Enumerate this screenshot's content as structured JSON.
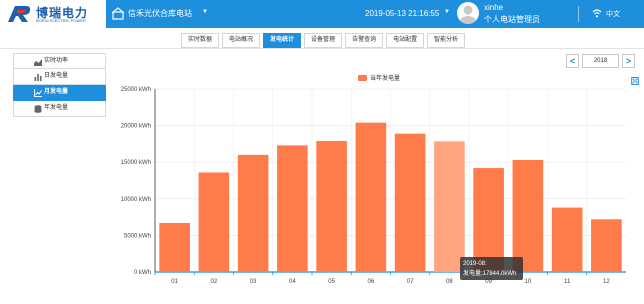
{
  "header": {
    "brand": "博瑞电力",
    "brand_sub": "BORUI ELECTRIC POWER",
    "station": "信禾光伏合库电站",
    "datetime": "2019-05-13 21:16:55",
    "user_name": "xinhe",
    "user_role": "个人电站管理员",
    "language": "中文",
    "caret": "▼"
  },
  "tabs": [
    {
      "label": "实时数据",
      "active": false
    },
    {
      "label": "电站概况",
      "active": false
    },
    {
      "label": "发电统计",
      "active": true
    },
    {
      "label": "设备管理",
      "active": false
    },
    {
      "label": "告警查询",
      "active": false
    },
    {
      "label": "电站配置",
      "active": false
    },
    {
      "label": "智能分析",
      "active": false
    }
  ],
  "sidebar": [
    {
      "label": "实时功率",
      "icon": "area-chart-icon",
      "active": false
    },
    {
      "label": "日发电量",
      "icon": "bar-chart-icon",
      "active": false
    },
    {
      "label": "月发电量",
      "icon": "line-chart-icon",
      "active": true
    },
    {
      "label": "年发电量",
      "icon": "database-icon",
      "active": false
    }
  ],
  "year_picker": {
    "prev": "<",
    "value": "2018",
    "next": ">"
  },
  "tooltip": {
    "line1": "2019-08:",
    "line2": "发电量:17844.0kWh"
  },
  "chart_data": {
    "type": "bar",
    "legend": "当年发电量",
    "legend_position": "top-center",
    "categories": [
      "01",
      "02",
      "03",
      "04",
      "05",
      "06",
      "07",
      "08",
      "09",
      "10",
      "11",
      "12"
    ],
    "values": [
      6700,
      13600,
      16000,
      17300,
      17900,
      20400,
      18900,
      17844,
      14200,
      15300,
      8800,
      7200
    ],
    "ylim": [
      0,
      25000
    ],
    "yticks": [
      "0 kWh",
      "5000 kWh",
      "10000 kWh",
      "15000 kWh",
      "20000 kWh",
      "25000 kWh"
    ],
    "bar_color": "#ff7c4a",
    "highlight_color": "#ffa47c",
    "highlight_index": 7,
    "grid": true
  }
}
